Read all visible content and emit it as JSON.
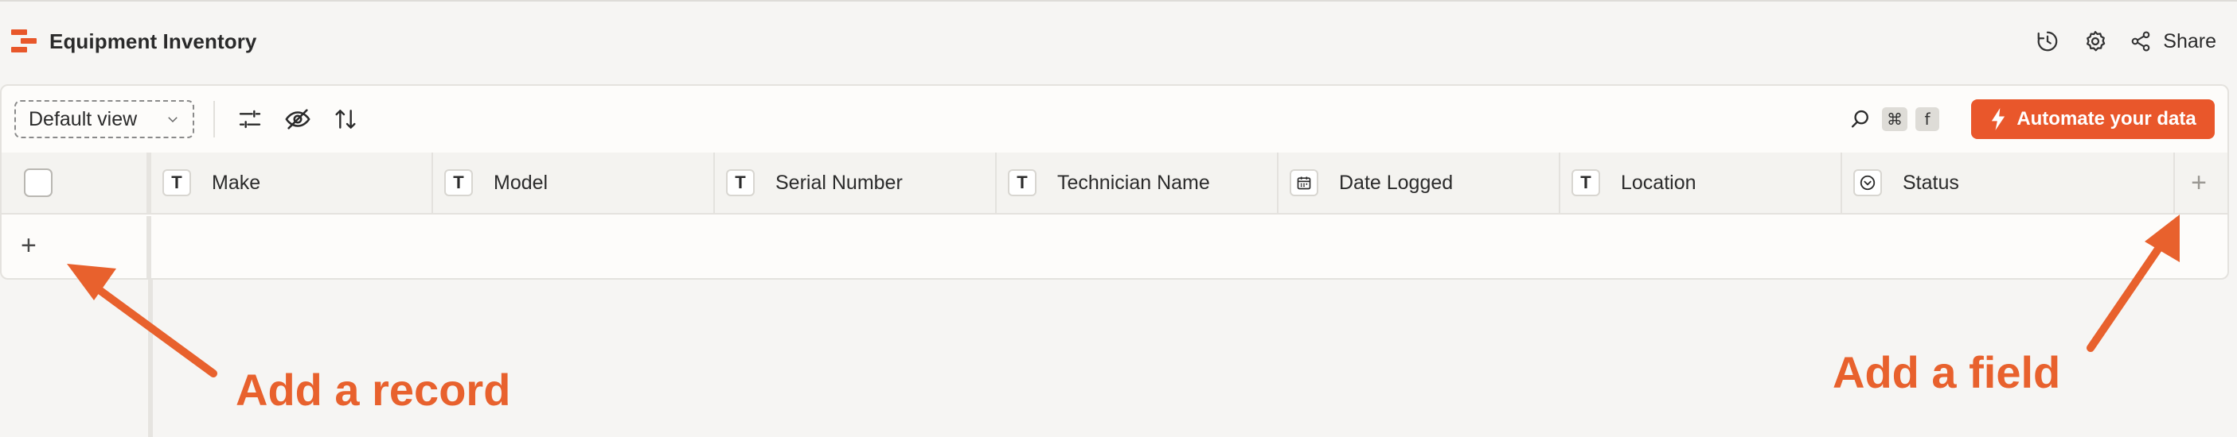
{
  "header": {
    "title": "Equipment Inventory",
    "share_label": "Share",
    "icons": [
      "history-icon",
      "settings-icon",
      "share-icon"
    ]
  },
  "toolbar": {
    "view_select": "Default view",
    "icons": [
      "filter-icon",
      "hide-fields-icon",
      "sort-icon",
      "search-icon"
    ],
    "shortcut_cmd": "⌘",
    "shortcut_key": "f",
    "automate_label": "Automate your data"
  },
  "columns": [
    {
      "label": "Make",
      "type": "T"
    },
    {
      "label": "Model",
      "type": "T"
    },
    {
      "label": "Serial Number",
      "type": "T"
    },
    {
      "label": "Technician Name",
      "type": "T"
    },
    {
      "label": "Date Logged",
      "type": "calendar"
    },
    {
      "label": "Location",
      "type": "T"
    },
    {
      "label": "Status",
      "type": "select"
    }
  ],
  "add_column_label": "+",
  "add_row_label": "+",
  "annotations": {
    "record": "Add a record",
    "field": "Add a field"
  },
  "colors": {
    "accent": "#e9572b",
    "background": "#f6f5f3",
    "annotation": "#e8612d"
  }
}
